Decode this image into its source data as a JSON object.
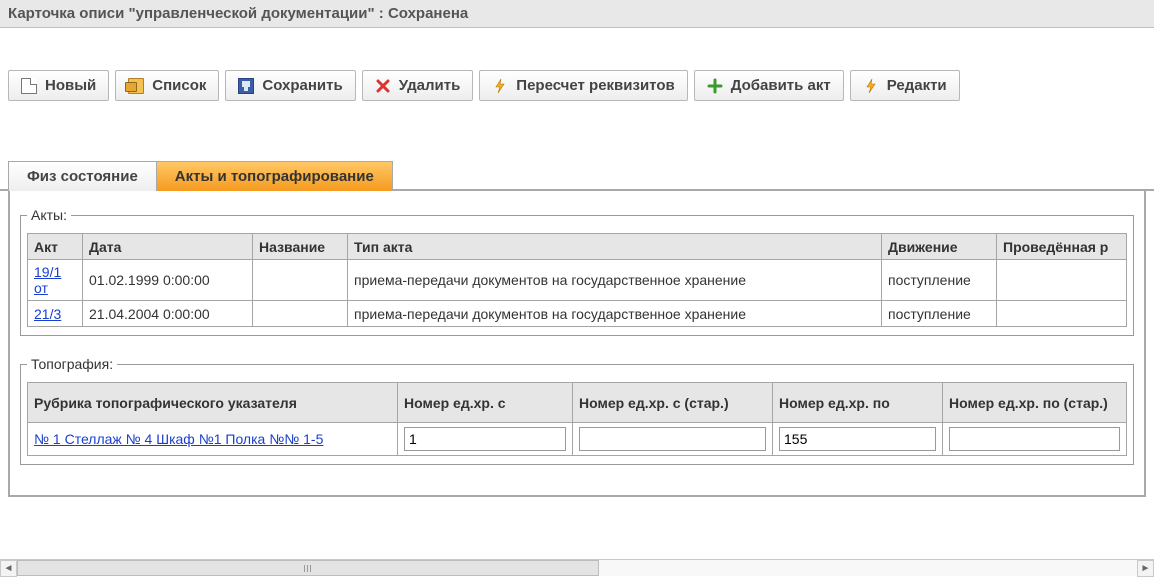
{
  "window": {
    "title": "Карточка описи \"управленческой документации\" : Сохранена"
  },
  "toolbar": {
    "new": "Новый",
    "list": "Список",
    "save": "Сохранить",
    "delete": "Удалить",
    "recalc": "Пересчет реквизитов",
    "add_act": "Добавить акт",
    "edit": "Редакти"
  },
  "tabs": {
    "phys": "Физ состояние",
    "acts": "Акты и топографирование"
  },
  "acts": {
    "legend": "Акты:",
    "headers": {
      "act": "Акт",
      "date": "Дата",
      "name": "Название",
      "type": "Тип акта",
      "movement": "Движение",
      "conducted": "Проведённая р"
    },
    "rows": [
      {
        "act": "19/1 от",
        "date": "01.02.1999 0:00:00",
        "name": "",
        "type": "приема-передачи документов на государственное хранение",
        "movement": "поступление",
        "conducted": ""
      },
      {
        "act": "21/3",
        "date": "21.04.2004 0:00:00",
        "name": "",
        "type": "приема-передачи документов на государственное хранение",
        "movement": "поступление",
        "conducted": ""
      }
    ]
  },
  "topo": {
    "legend": "Топография:",
    "headers": {
      "rubric": "Рубрика топографического указателя",
      "from": "Номер ед.хр. с",
      "from_old": "Номер ед.хр. с (стар.)",
      "to": "Номер ед.хр. по",
      "to_old": "Номер ед.хр. по (стар.)"
    },
    "rows": [
      {
        "rubric": "№ 1 Стеллаж № 4 Шкаф №1 Полка №№ 1-5",
        "from": "1",
        "from_old": "",
        "to": "155",
        "to_old": ""
      }
    ]
  }
}
